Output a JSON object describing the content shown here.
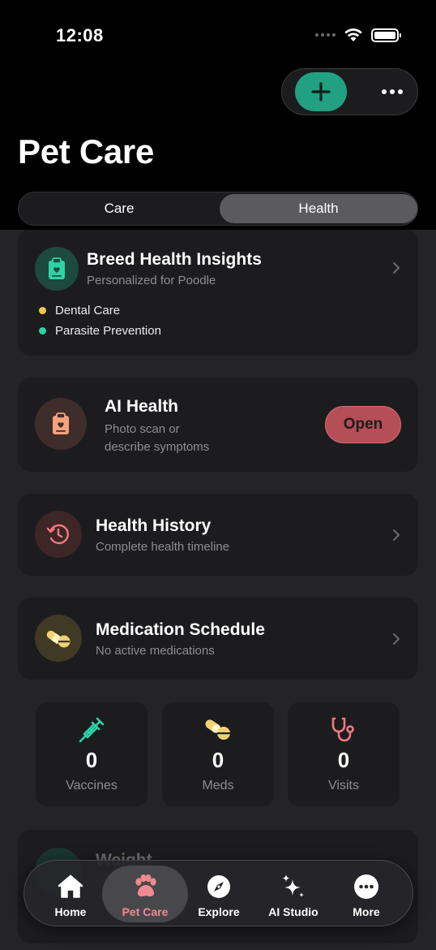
{
  "status": {
    "time": "12:08"
  },
  "header": {
    "title": "Pet Care"
  },
  "segments": [
    {
      "label": "Care"
    },
    {
      "label": "Health",
      "selected": true
    }
  ],
  "breed_card": {
    "title": "Breed Health Insights",
    "subtitle": "Personalized for Poodle",
    "items": [
      {
        "label": "Dental Care",
        "color": "#f2c94c"
      },
      {
        "label": "Parasite Prevention",
        "color": "#2fd1a5"
      }
    ]
  },
  "ai_card": {
    "title": "AI Health",
    "subtitle_line1": "Photo scan or",
    "subtitle_line2": "describe symptoms",
    "button": "Open"
  },
  "history_card": {
    "title": "Health History",
    "subtitle": "Complete health timeline"
  },
  "medication_card": {
    "title": "Medication Schedule",
    "subtitle": "No active medications"
  },
  "stats": [
    {
      "value": "0",
      "label": "Vaccines",
      "icon": "syringe-icon"
    },
    {
      "value": "0",
      "label": "Meds",
      "icon": "pills-icon"
    },
    {
      "value": "0",
      "label": "Visits",
      "icon": "stethoscope-icon"
    }
  ],
  "weight_card": {
    "title": "Weight"
  },
  "tabbar": [
    {
      "label": "Home",
      "icon": "home-icon"
    },
    {
      "label": "Pet Care",
      "icon": "paw-icon",
      "active": true
    },
    {
      "label": "Explore",
      "icon": "compass-icon"
    },
    {
      "label": "AI Studio",
      "icon": "sparkles-icon"
    },
    {
      "label": "More",
      "icon": "more-icon"
    }
  ],
  "colors": {
    "accent_green": "#22a082",
    "accent_red": "#f08a90",
    "card_bg": "#1c1c1e",
    "page_bg": "#242427"
  }
}
